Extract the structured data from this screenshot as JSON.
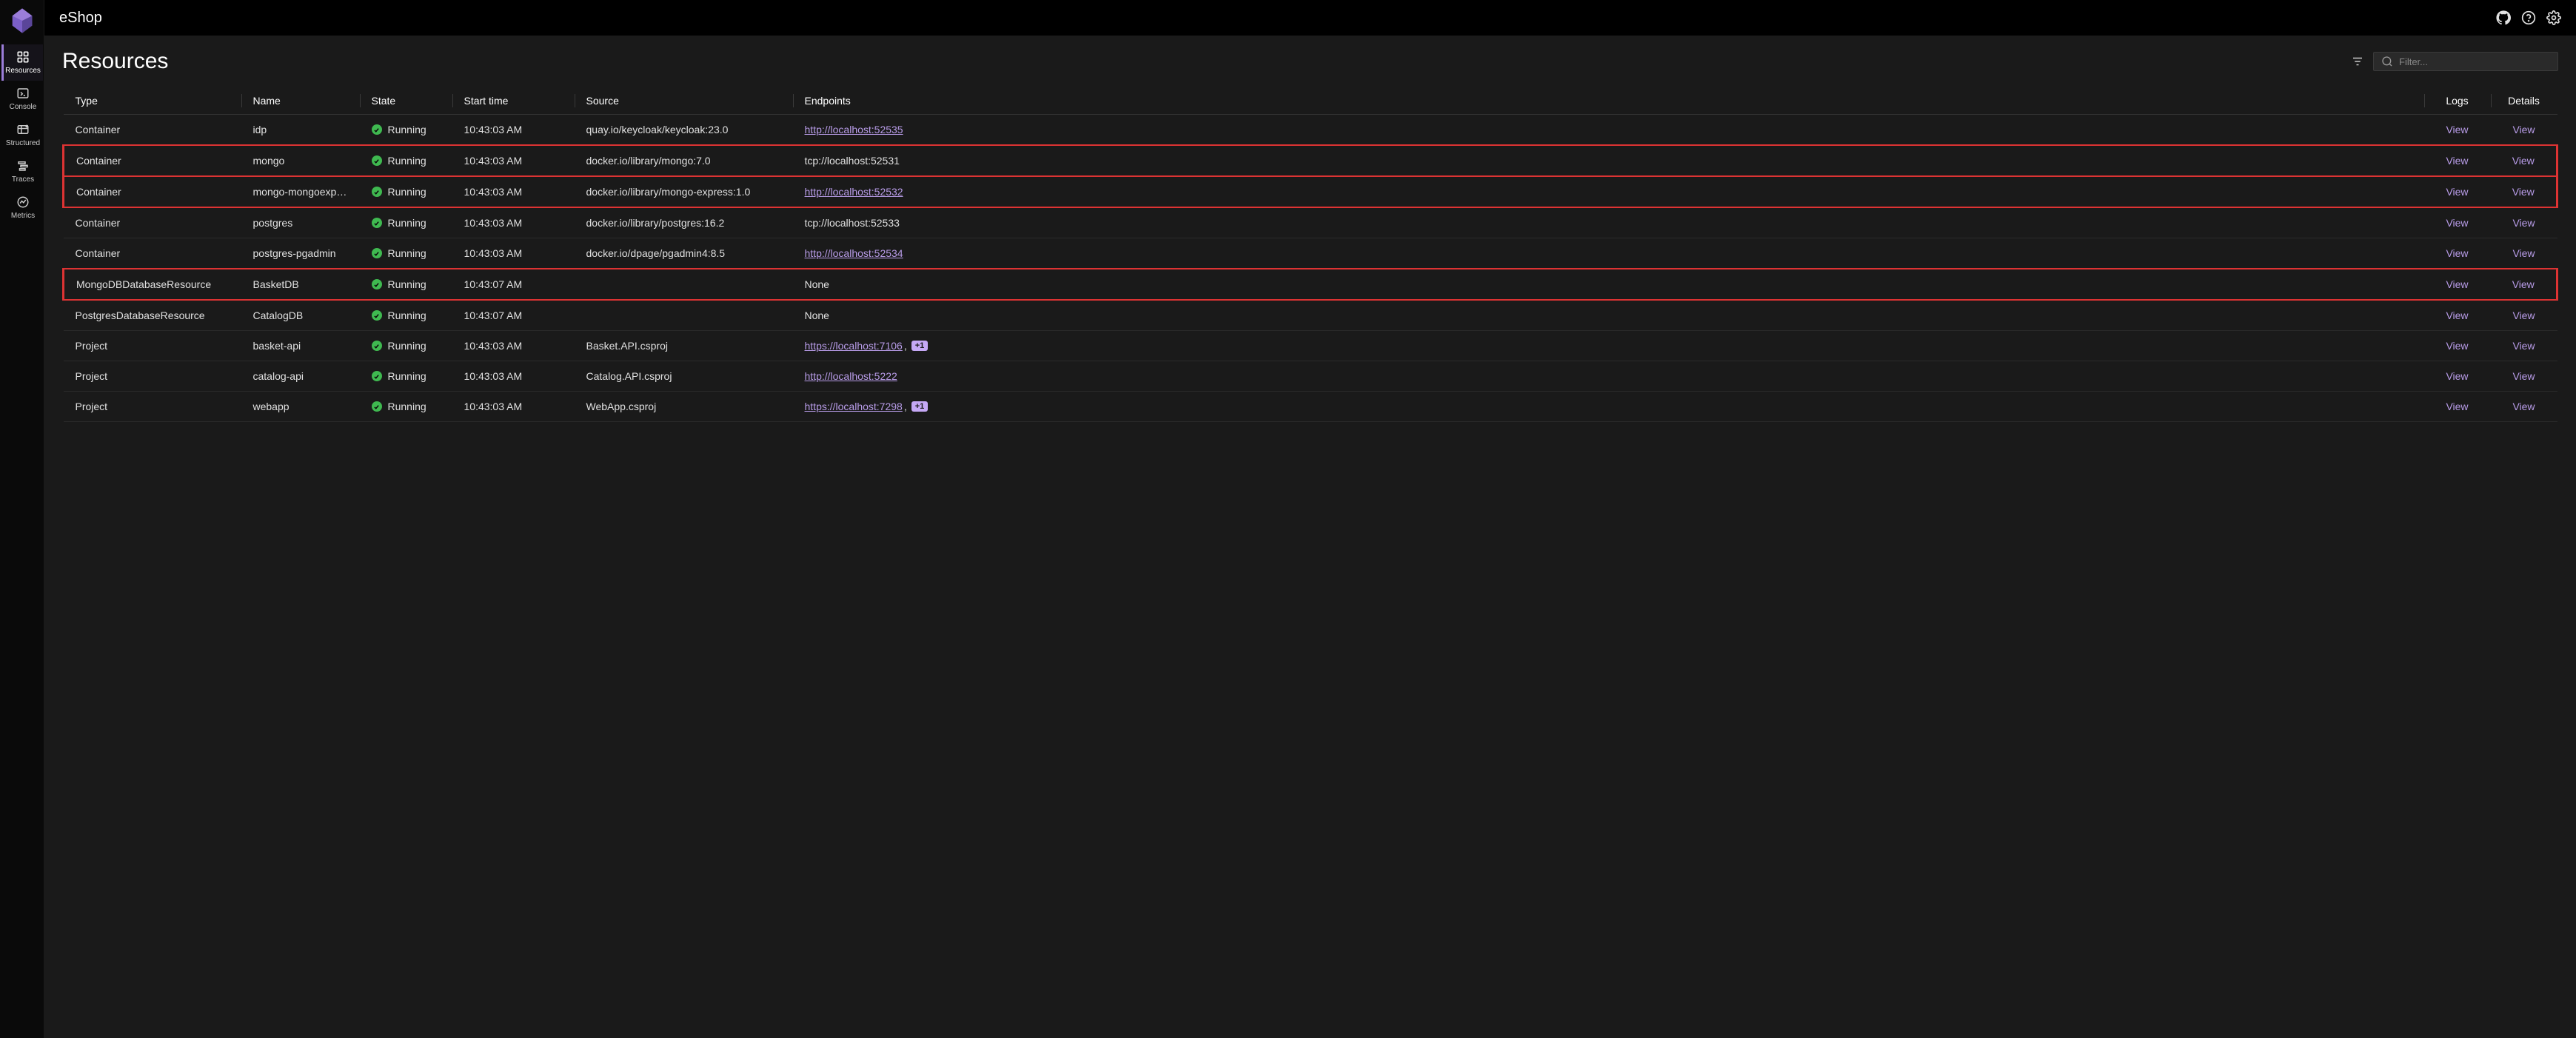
{
  "app_title": "eShop",
  "page_title": "Resources",
  "search_placeholder": "Filter...",
  "nav": [
    {
      "id": "resources",
      "label": "Resources",
      "active": true
    },
    {
      "id": "console",
      "label": "Console",
      "active": false
    },
    {
      "id": "structured",
      "label": "Structured",
      "active": false
    },
    {
      "id": "traces",
      "label": "Traces",
      "active": false
    },
    {
      "id": "metrics",
      "label": "Metrics",
      "active": false
    }
  ],
  "columns": {
    "type": "Type",
    "name": "Name",
    "state": "State",
    "start": "Start time",
    "source": "Source",
    "endpoints": "Endpoints",
    "logs": "Logs",
    "details": "Details"
  },
  "view_label": "View",
  "rows": [
    {
      "type": "Container",
      "name": "idp",
      "state": "Running",
      "start": "10:43:03 AM",
      "source": "quay.io/keycloak/keycloak:23.0",
      "endpoint": "http://localhost:52535",
      "endpoint_is_link": true,
      "extra": "",
      "highlighted": false
    },
    {
      "type": "Container",
      "name": "mongo",
      "state": "Running",
      "start": "10:43:03 AM",
      "source": "docker.io/library/mongo:7.0",
      "endpoint": "tcp://localhost:52531",
      "endpoint_is_link": false,
      "extra": "",
      "highlighted": true
    },
    {
      "type": "Container",
      "name": "mongo-mongoexpr...",
      "state": "Running",
      "start": "10:43:03 AM",
      "source": "docker.io/library/mongo-express:1.0",
      "endpoint": "http://localhost:52532",
      "endpoint_is_link": true,
      "extra": "",
      "highlighted": true
    },
    {
      "type": "Container",
      "name": "postgres",
      "state": "Running",
      "start": "10:43:03 AM",
      "source": "docker.io/library/postgres:16.2",
      "endpoint": "tcp://localhost:52533",
      "endpoint_is_link": false,
      "extra": "",
      "highlighted": false
    },
    {
      "type": "Container",
      "name": "postgres-pgadmin",
      "state": "Running",
      "start": "10:43:03 AM",
      "source": "docker.io/dpage/pgadmin4:8.5",
      "endpoint": "http://localhost:52534",
      "endpoint_is_link": true,
      "extra": "",
      "highlighted": false
    },
    {
      "type": "MongoDBDatabaseResource",
      "name": "BasketDB",
      "state": "Running",
      "start": "10:43:07 AM",
      "source": "",
      "endpoint": "None",
      "endpoint_is_link": false,
      "extra": "",
      "highlighted": true
    },
    {
      "type": "PostgresDatabaseResource",
      "name": "CatalogDB",
      "state": "Running",
      "start": "10:43:07 AM",
      "source": "",
      "endpoint": "None",
      "endpoint_is_link": false,
      "extra": "",
      "highlighted": false
    },
    {
      "type": "Project",
      "name": "basket-api",
      "state": "Running",
      "start": "10:43:03 AM",
      "source": "Basket.API.csproj",
      "endpoint": "https://localhost:7106",
      "endpoint_is_link": true,
      "extra": "+1",
      "highlighted": false
    },
    {
      "type": "Project",
      "name": "catalog-api",
      "state": "Running",
      "start": "10:43:03 AM",
      "source": "Catalog.API.csproj",
      "endpoint": "http://localhost:5222",
      "endpoint_is_link": true,
      "extra": "",
      "highlighted": false
    },
    {
      "type": "Project",
      "name": "webapp",
      "state": "Running",
      "start": "10:43:03 AM",
      "source": "WebApp.csproj",
      "endpoint": "https://localhost:7298",
      "endpoint_is_link": true,
      "extra": "+1",
      "highlighted": false
    }
  ]
}
